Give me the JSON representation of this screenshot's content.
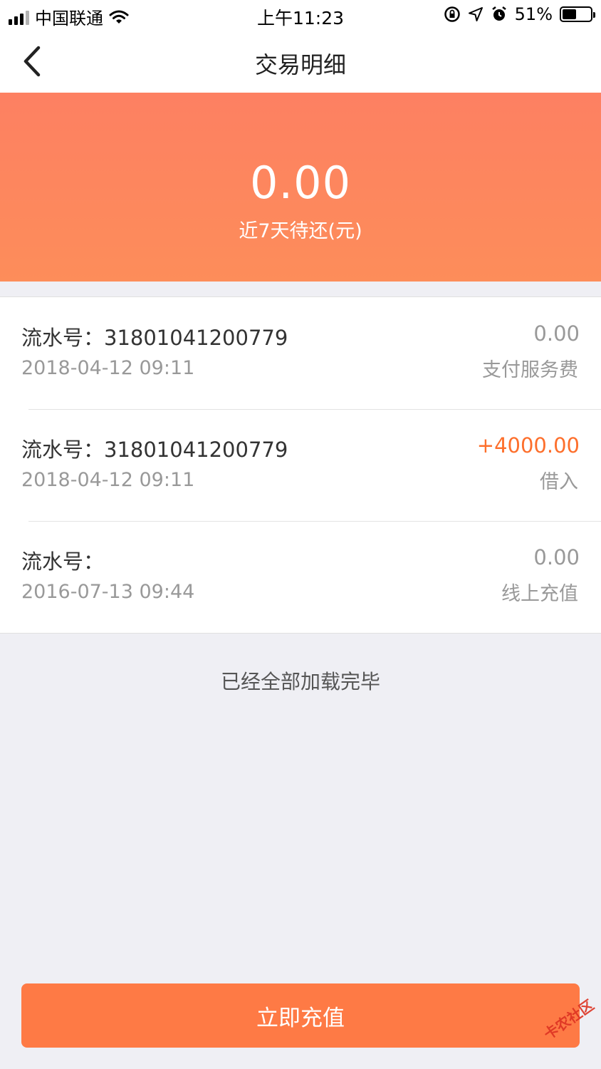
{
  "status_bar": {
    "carrier": "中国联通",
    "time": "上午11:23",
    "battery_text": "51%",
    "battery_level": 0.51
  },
  "nav": {
    "title": "交易明细"
  },
  "banner": {
    "amount": "0.00",
    "label": "近7天待还(元)"
  },
  "transactions": [
    {
      "serial": "流水号：31801041200779",
      "date": "2018-04-12 09:11",
      "amount": "0.00",
      "type": "支付服务费",
      "positive": false
    },
    {
      "serial": "流水号：31801041200779",
      "date": "2018-04-12 09:11",
      "amount": "+4000.00",
      "type": "借入",
      "positive": true
    },
    {
      "serial": "流水号：",
      "date": "2016-07-13 09:44",
      "amount": "0.00",
      "type": "线上充值",
      "positive": false
    }
  ],
  "load_done_text": "已经全部加载完毕",
  "recharge_button": "立即充值",
  "watermark": "卡农社区",
  "colors": {
    "accent": "#fe7a45",
    "positive_amount": "#fd6f2c",
    "banner_top": "#fd8062",
    "banner_bottom": "#fd8d5a"
  }
}
